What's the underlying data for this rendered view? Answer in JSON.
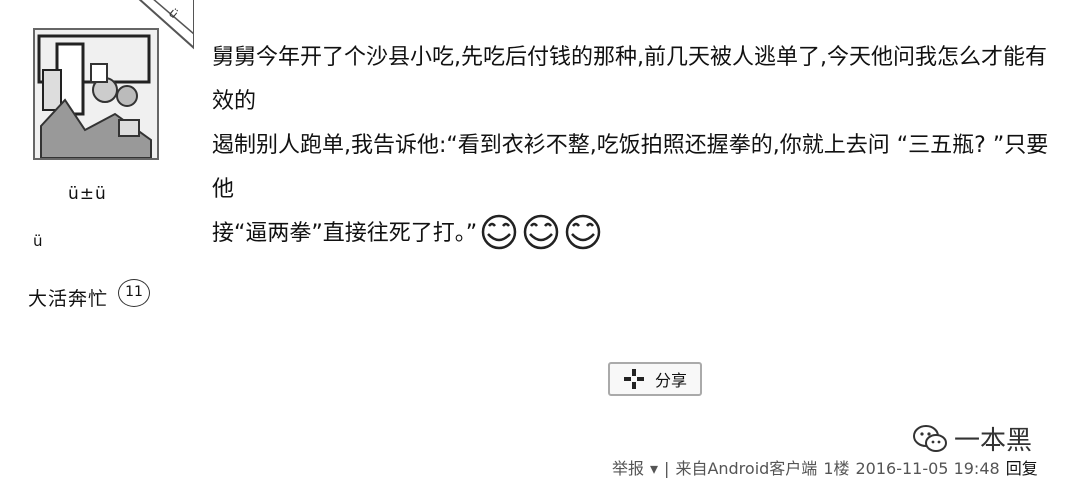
{
  "user": {
    "name": "ü±ü",
    "note": "ü",
    "level_label": "大活奔忙",
    "level_number": "11",
    "corner_badge": "ü"
  },
  "post": {
    "lines": [
      "舅舅今年开了个沙县小吃,先吃后付钱的那种,前几天被人逃单了,今天他问我怎么才能有效的",
      "遏制别人跑单,我告诉他:“看到衣衫不整,吃饭拍照还握拳的,你就上去问 “三五瓶? ”只要他",
      "接“逼两拳”直接往死了打。”"
    ]
  },
  "share": {
    "label": "分享",
    "icon": "share-plus-icon"
  },
  "watermark": {
    "text": "一本黑",
    "icon": "wechat-icon"
  },
  "footer": {
    "report": "举报",
    "separator": "|",
    "source": "来自Android客户端",
    "floor": "1楼",
    "timestamp": "2016-11-05 19:48",
    "reply": "回复"
  }
}
